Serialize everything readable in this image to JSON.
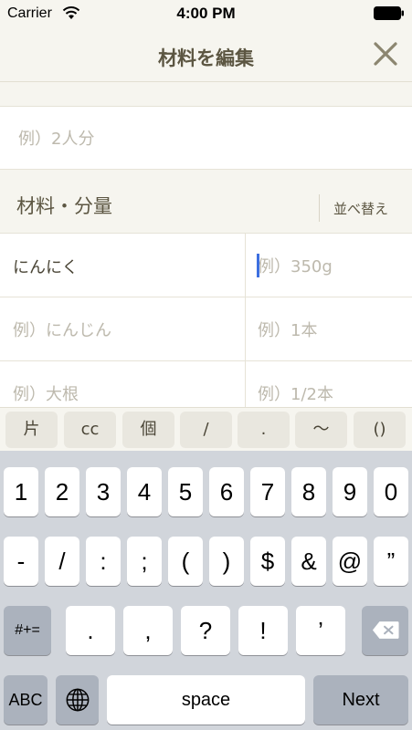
{
  "status": {
    "carrier": "Carrier",
    "time": "4:00 PM"
  },
  "nav": {
    "title": "材料を編集"
  },
  "servings": {
    "placeholder": "例）2人分",
    "value": ""
  },
  "section": {
    "title": "材料・分量",
    "sort_label": "並べ替え"
  },
  "ingredients": [
    {
      "name": "にんにく",
      "name_placeholder": "",
      "amount": "",
      "amount_placeholder": "例）350g"
    },
    {
      "name": "",
      "name_placeholder": "例）にんじん",
      "amount": "",
      "amount_placeholder": "例）1本"
    },
    {
      "name": "",
      "name_placeholder": "例）大根",
      "amount": "",
      "amount_placeholder": "例）1/2本"
    }
  ],
  "accessory_keys": [
    "片",
    "cc",
    "個",
    "/",
    ".",
    "〜",
    "()"
  ],
  "keyboard": {
    "row1": [
      "1",
      "2",
      "3",
      "4",
      "5",
      "6",
      "7",
      "8",
      "9",
      "0"
    ],
    "row2": [
      "-",
      "/",
      ":",
      ";",
      "(",
      ")",
      "$",
      "&",
      "@",
      "”"
    ],
    "row3_left": "#+=",
    "row3": [
      ".",
      ",",
      "?",
      "!",
      "’"
    ],
    "abc": "ABC",
    "space": "space",
    "next": "Next"
  },
  "colors": {
    "accent": "#3d6fe0",
    "background": "#f6f5ef",
    "keyboard": "#d1d5db"
  },
  "icons": {
    "wifi": "wifi-icon",
    "battery": "battery-icon",
    "close": "close-icon",
    "globe": "globe-icon",
    "delete": "delete-icon"
  }
}
